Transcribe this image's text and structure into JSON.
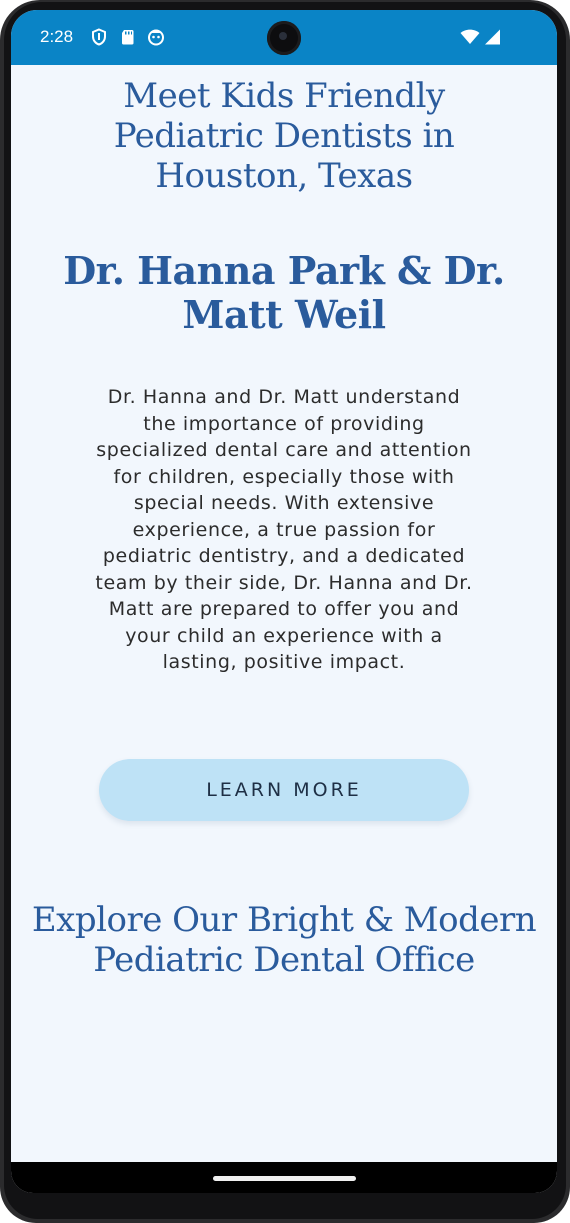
{
  "status_bar": {
    "time": "2:28",
    "left_icons": [
      "shield-icon",
      "sd-card-icon",
      "face-icon"
    ],
    "right_icons": [
      "wifi-icon",
      "cell-signal-icon"
    ],
    "color": "#0a84c6"
  },
  "page": {
    "intro_heading": "Meet Kids Friendly Pediatric Dentists in Houston, Texas",
    "doctors_heading": "Dr. Hanna Park & Dr. Matt Weil",
    "bio": "Dr. Hanna and Dr. Matt understand the importance of providing specialized dental care and attention for children, especially those with special needs. With extensive experience, a true passion for pediatric dentistry, and a dedicated team by their side, Dr. Hanna and Dr. Matt are prepared to offer you and your child an experience with a lasting, positive impact.",
    "learn_more_label": "LEARN MORE",
    "office_heading": "Explore Our Bright & Modern Pediatric Dental Office"
  },
  "colors": {
    "heading": "#2a5b9c",
    "background": "#f2f7fd",
    "button": "#bee2f6"
  }
}
